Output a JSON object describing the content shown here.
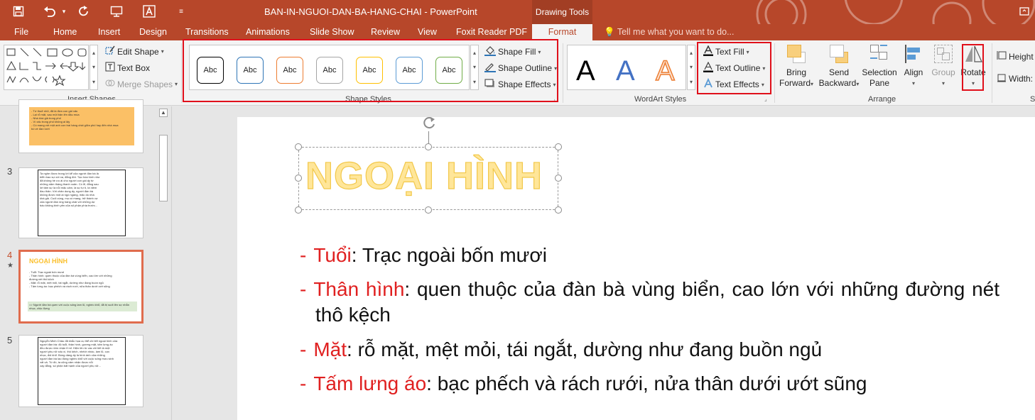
{
  "window": {
    "title": "BAN-IN-NGUOI-DAN-BA-HANG-CHAI - PowerPoint",
    "contextual_tab_group": "Drawing Tools"
  },
  "tabs": [
    "File",
    "Home",
    "Insert",
    "Design",
    "Transitions",
    "Animations",
    "Slide Show",
    "Review",
    "View",
    "Foxit Reader PDF"
  ],
  "active_tab": "Format",
  "tell_me_placeholder": "Tell me what you want to do...",
  "ribbon": {
    "insert_shapes": {
      "label": "Insert Shapes",
      "edit_shape": "Edit Shape",
      "text_box": "Text Box",
      "merge_shapes": "Merge Shapes"
    },
    "shape_styles": {
      "label": "Shape Styles",
      "styles": [
        {
          "text": "Abc",
          "border": "#000000"
        },
        {
          "text": "Abc",
          "border": "#2e75b6"
        },
        {
          "text": "Abc",
          "border": "#ed7d31"
        },
        {
          "text": "Abc",
          "border": "#a5a5a5"
        },
        {
          "text": "Abc",
          "border": "#ffc000"
        },
        {
          "text": "Abc",
          "border": "#5b9bd5"
        },
        {
          "text": "Abc",
          "border": "#70ad47"
        }
      ],
      "shape_fill": "Shape Fill",
      "shape_outline": "Shape Outline",
      "shape_effects": "Shape Effects"
    },
    "wordart_styles": {
      "label": "WordArt Styles",
      "samples": [
        {
          "text": "A",
          "color": "#000000"
        },
        {
          "text": "A",
          "color": "#4472c4"
        },
        {
          "text": "A",
          "color": "#ed7d31"
        }
      ],
      "text_fill": "Text Fill",
      "text_outline": "Text Outline",
      "text_effects": "Text Effects"
    },
    "arrange": {
      "label": "Arrange",
      "bring_forward": [
        "Bring",
        "Forward"
      ],
      "send_backward": [
        "Send",
        "Backward"
      ],
      "selection_pane": [
        "Selection",
        "Pane"
      ],
      "align": "Align",
      "group": "Group",
      "rotate": "Rotate"
    },
    "size": {
      "height": "Height",
      "width": "Width:",
      "label_fragment": "S"
    }
  },
  "thumbnails": [
    {
      "number": "",
      "lines": [
        "- Tứ thuở nhỏ, đã là đứa con gái xấu",
        "- Lại rỗ mặt, sau một bận lên đậu mùa",
        "- Nhà khá giả trong phố",
        "- Vì xấu trong phố không ai lấy",
        "- Có mang với một anh con trai hàng chài giữa phố hay đến nhà mua",
        "  bò về đan lưới"
      ]
    },
    {
      "number": "3",
      "lines": [
        "Ta nghe được trong lời kể của người đàn bà là",
        "biển bao sự xót xa, đắng đót. Tạo hóa hình như",
        "đã không hề ưu ái cho người con gái ấy từ",
        "những năm tháng thanh xuân. Có lẽ, đằng sau",
        "lời tâm sự là nỗi mặc cảm, là sự tự ti, là niềm",
        "đau thân. Với chân dung ấy, người đàn bà",
        "không được một ai ngó ngàng, mặc dù nhà",
        "khá giả. Cuối cùng, mụ có mang, trở thành vợ",
        "của người đàn ông hàng chài với những dự",
        "báo không bình yên của số phận phía trước..."
      ]
    },
    {
      "number": "4",
      "title": "NGOẠI HÌNH",
      "lines": [
        "- Tuổi: Trạc ngoài bốn mươi",
        "- Thân hình: quen thuộc của đàn bà vùng biển, cao lớn với những",
        "  đường nét thô kệch",
        "- Mặt: rỗ mặt, mệt mỏi, tái ngắt, dường như đang buồn ngủ",
        "- Tấm lưng áo: bạc phếch và rách rưới, nửa thân dưới ướt sũng"
      ],
      "note": "=> Người đàn bà quen với cuộc sống lam lũ, nghèo khổ, đã bị suốt lên sự nhẫn nhục, chịu đựng",
      "star": "★"
    },
    {
      "number": "5",
      "lines": [
        "Nguyễn Minh Châu đã khắc họa cụ thể chi tiết ngoại hình của",
        "người đàn bà: độ tuổi, thân hình, gương mặt, tấm lưng áo",
        "đều được nhìn nhận tỉ mỉ. Hiện lên từ các chi tiết là một",
        "người phụ nữ xấu xí, thô kệch, nhếch nhác, lam lũ, cực",
        "nhọc, đói khổ. Bóng dáng ấy là hình ảnh của những",
        "người đàn bà lao động nghèo khổ với cuộc sống mưu sinh",
        "vất vả. Từ đó, ta cũng cảm nhận được nỗi",
        "cay đắng, số phận bất hạnh của người phụ nữ..."
      ]
    }
  ],
  "slide": {
    "title": "NGOẠI HÌNH",
    "bullets": [
      {
        "key": "Tuổi",
        "text": ": Trạc ngoài bốn mươi"
      },
      {
        "key": "Thân hình",
        "text": ": quen thuộc của đàn bà vùng biển, cao lớn với những đường nét thô kệch"
      },
      {
        "key": "Mặt",
        "text": ": rỗ mặt, mệt mỏi, tái ngắt, dường như đang buồn ngủ"
      },
      {
        "key": "Tấm lưng áo",
        "text": ": bạc phếch và rách rưới, nửa thân dưới ướt sũng"
      }
    ]
  },
  "colors": {
    "accent": "#b7472a",
    "highlight_box": "#e0101b",
    "bullet_key": "#e02020",
    "wordart_fill": "#ffe699"
  }
}
